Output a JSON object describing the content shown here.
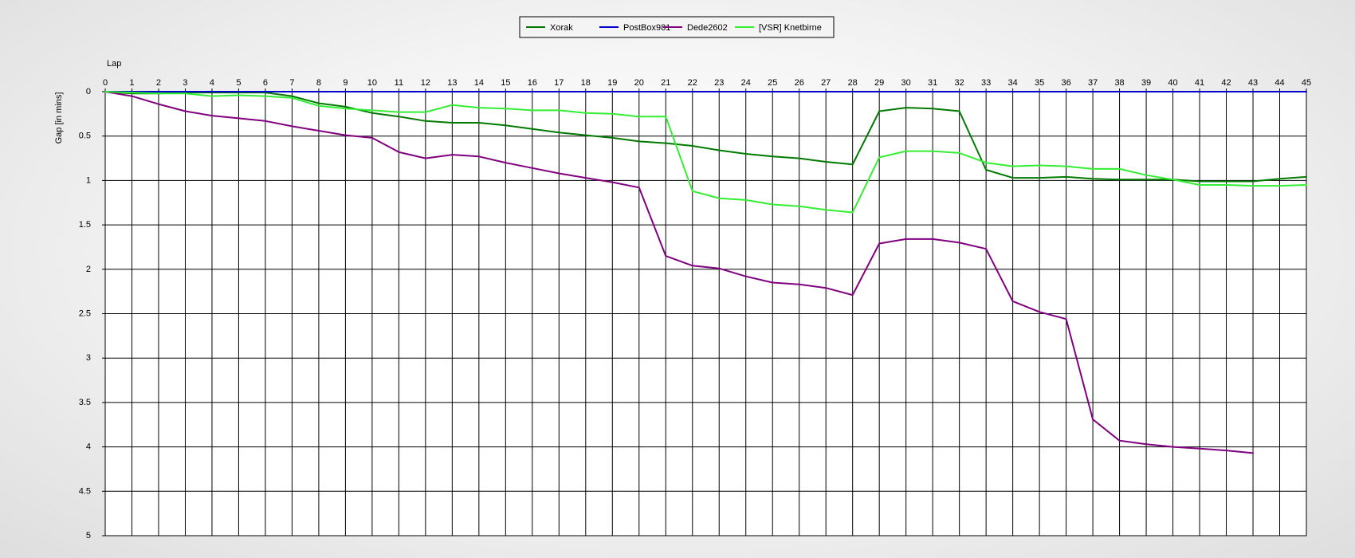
{
  "chart_data": {
    "type": "line",
    "title": "",
    "xlabel": "Lap",
    "ylabel": "Gap [in mins]",
    "xlim": [
      0,
      45
    ],
    "ylim": [
      0,
      5
    ],
    "y_inverted": true,
    "x_axis_position": "top",
    "grid": true,
    "legend_position": "top-center",
    "x_ticks": [
      0,
      1,
      2,
      3,
      4,
      5,
      6,
      7,
      8,
      9,
      10,
      11,
      12,
      13,
      14,
      15,
      16,
      17,
      18,
      19,
      20,
      21,
      22,
      23,
      24,
      25,
      26,
      27,
      28,
      29,
      30,
      31,
      32,
      33,
      34,
      35,
      36,
      37,
      38,
      39,
      40,
      41,
      42,
      43,
      44,
      45
    ],
    "y_ticks": [
      "0",
      "0.5",
      "1",
      "1.5",
      "2",
      "2.5",
      "3",
      "3.5",
      "4",
      "4.5",
      "5"
    ],
    "series": [
      {
        "name": "Xorak",
        "color": "#007a00",
        "x": [
          0,
          1,
          2,
          3,
          4,
          5,
          6,
          7,
          8,
          9,
          10,
          11,
          12,
          13,
          14,
          15,
          16,
          17,
          18,
          19,
          20,
          21,
          22,
          23,
          24,
          25,
          26,
          27,
          28,
          29,
          30,
          31,
          32,
          33,
          34,
          35,
          36,
          37,
          38,
          39,
          40,
          41,
          42,
          43,
          44,
          45
        ],
        "values": [
          0,
          0.02,
          0.02,
          0.01,
          0.01,
          0.01,
          0.01,
          0.05,
          0.13,
          0.17,
          0.24,
          0.28,
          0.33,
          0.35,
          0.35,
          0.38,
          0.42,
          0.46,
          0.49,
          0.52,
          0.56,
          0.58,
          0.61,
          0.66,
          0.7,
          0.73,
          0.75,
          0.79,
          0.82,
          0.22,
          0.18,
          0.19,
          0.22,
          0.88,
          0.97,
          0.97,
          0.96,
          0.98,
          0.99,
          0.99,
          0.99,
          1.01,
          1.01,
          1.01,
          0.98,
          0.96
        ]
      },
      {
        "name": "PostBox981",
        "color": "#0000cc",
        "x": [
          0,
          45
        ],
        "values": [
          0,
          0
        ]
      },
      {
        "name": "Dede2602",
        "color": "#800080",
        "x": [
          0,
          1,
          2,
          3,
          4,
          5,
          6,
          7,
          8,
          9,
          10,
          11,
          12,
          13,
          14,
          15,
          16,
          17,
          18,
          19,
          20,
          21,
          22,
          23,
          24,
          25,
          26,
          27,
          28,
          29,
          30,
          31,
          32,
          33,
          34,
          35,
          36,
          37,
          38,
          39,
          40,
          41,
          42,
          43
        ],
        "values": [
          0,
          0.05,
          0.14,
          0.22,
          0.27,
          0.3,
          0.33,
          0.39,
          0.44,
          0.49,
          0.52,
          0.68,
          0.75,
          0.71,
          0.73,
          0.8,
          0.86,
          0.92,
          0.97,
          1.02,
          1.08,
          1.85,
          1.96,
          1.99,
          2.08,
          2.15,
          2.17,
          2.21,
          2.29,
          1.71,
          1.66,
          1.66,
          1.7,
          1.77,
          2.36,
          2.48,
          2.56,
          3.69,
          3.93,
          3.97,
          4.0,
          4.02,
          4.04,
          4.07
        ]
      },
      {
        "name": "[VSR] Knetbirne",
        "color": "#33ee33",
        "x": [
          0,
          1,
          2,
          3,
          4,
          5,
          6,
          7,
          8,
          9,
          10,
          11,
          12,
          13,
          14,
          15,
          16,
          17,
          18,
          19,
          20,
          21,
          22,
          23,
          24,
          25,
          26,
          27,
          28,
          29,
          30,
          31,
          32,
          33,
          34,
          35,
          36,
          37,
          38,
          39,
          40,
          41,
          42,
          43,
          44,
          45
        ],
        "values": [
          0,
          0.01,
          0.02,
          0.02,
          0.05,
          0.04,
          0.05,
          0.07,
          0.16,
          0.19,
          0.21,
          0.23,
          0.23,
          0.15,
          0.18,
          0.19,
          0.21,
          0.21,
          0.24,
          0.25,
          0.28,
          0.28,
          1.12,
          1.2,
          1.22,
          1.27,
          1.29,
          1.33,
          1.36,
          0.74,
          0.67,
          0.67,
          0.69,
          0.8,
          0.84,
          0.83,
          0.84,
          0.87,
          0.87,
          0.94,
          0.99,
          1.05,
          1.05,
          1.06,
          1.06,
          1.05
        ]
      }
    ]
  }
}
